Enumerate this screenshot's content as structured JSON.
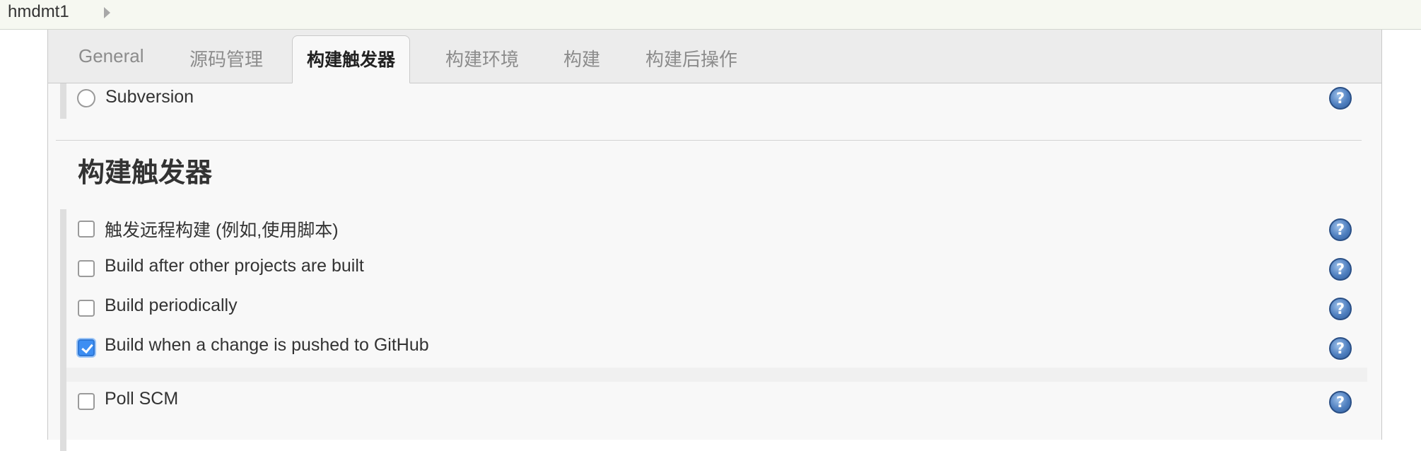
{
  "breadcrumb": {
    "job_name": "hmdmt1"
  },
  "tabs": [
    {
      "label": "General",
      "active": false
    },
    {
      "label": "源码管理",
      "active": false
    },
    {
      "label": "构建触发器",
      "active": true
    },
    {
      "label": "构建环境",
      "active": false
    },
    {
      "label": "构建",
      "active": false
    },
    {
      "label": "构建后操作",
      "active": false
    }
  ],
  "scm": {
    "subversion_label": "Subversion",
    "subversion_selected": false
  },
  "triggers": {
    "section_title": "构建触发器",
    "items": [
      {
        "label": "触发远程构建 (例如,使用脚本)",
        "checked": false
      },
      {
        "label": "Build after other projects are built",
        "checked": false
      },
      {
        "label": "Build periodically",
        "checked": false
      },
      {
        "label": "Build when a change is pushed to GitHub",
        "checked": true
      },
      {
        "label": "Poll SCM",
        "checked": false
      }
    ]
  },
  "help_icon_glyph": "?",
  "colors": {
    "topbar_bg": "#f6f8f1",
    "panel_bg": "#f8f8f8",
    "checkbox_checked": "#3d8ef2",
    "help_icon": "#4f7fbf"
  }
}
